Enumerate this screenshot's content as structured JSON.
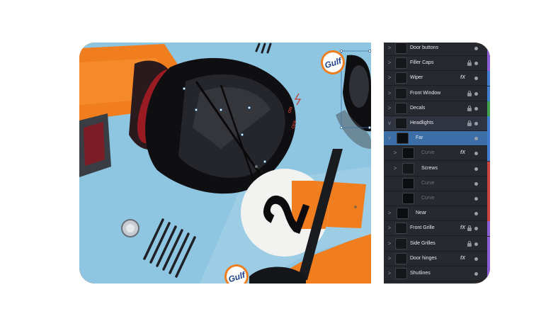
{
  "colors": {
    "car_blue": "#8ec5e0",
    "car_orange": "#f07e1e",
    "panel_bg": "#26292e",
    "selection": "#3c6fa8",
    "tag_purple": "#8c5bd6",
    "tag_blue": "#3f7fd0",
    "tag_green": "#3fa350",
    "tag_red": "#c9443d"
  },
  "canvas": {
    "race_number": "2",
    "logo_text": "Gulf",
    "switch_on": "ON",
    "switch_off": "OFF"
  },
  "layers_panel": {
    "layers": [
      {
        "label": "Door buttons",
        "chevron": ">",
        "fx": "",
        "locked": false,
        "tag": "tag_purple"
      },
      {
        "label": "Filler Caps",
        "chevron": ">",
        "fx": "",
        "locked": true,
        "tag": "tag_purple"
      },
      {
        "label": "Wiper",
        "chevron": ">",
        "fx": "fX",
        "locked": false,
        "tag": "tag_blue"
      },
      {
        "label": "Front Window",
        "chevron": ">",
        "fx": "",
        "locked": true,
        "tag": "tag_blue"
      },
      {
        "label": "Decals",
        "chevron": ">",
        "fx": "",
        "locked": true,
        "tag": "tag_green"
      },
      {
        "label": "Headlights",
        "chevron": "v",
        "fx": "",
        "locked": true,
        "tag": "tag_blue"
      },
      {
        "label": "Far",
        "chevron": "v",
        "fx": "",
        "locked": false,
        "tag": "tag_blue"
      },
      {
        "label": "Curve",
        "chevron": ">",
        "fx": "fX",
        "locked": false,
        "tag": "tag_blue"
      },
      {
        "label": "Screws",
        "chevron": ">",
        "fx": "",
        "locked": false,
        "tag": "tag_red"
      },
      {
        "label": "Curve",
        "chevron": "",
        "fx": "",
        "locked": false,
        "tag": "tag_red"
      },
      {
        "label": "Curve",
        "chevron": "",
        "fx": "",
        "locked": false,
        "tag": "tag_red"
      },
      {
        "label": "Near",
        "chevron": ">",
        "fx": "",
        "locked": false,
        "tag": "tag_red"
      },
      {
        "label": "Front Grille",
        "chevron": ">",
        "fx": "fX",
        "locked": true,
        "tag": "tag_purple"
      },
      {
        "label": "Side Grilles",
        "chevron": ">",
        "fx": "",
        "locked": true,
        "tag": "tag_purple"
      },
      {
        "label": "Door hinges",
        "chevron": ">",
        "fx": "fX",
        "locked": false,
        "tag": "tag_purple"
      },
      {
        "label": "Shutlines",
        "chevron": ">",
        "fx": "",
        "locked": false,
        "tag": "tag_purple"
      }
    ]
  }
}
